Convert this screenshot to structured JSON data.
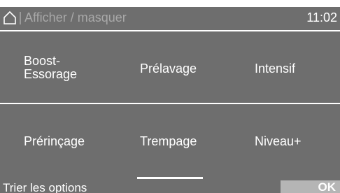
{
  "header": {
    "home_icon": "home-icon",
    "title": "Afficher / masquer",
    "time": "11:02"
  },
  "options": {
    "row1": {
      "boost_line1": "Boost-",
      "boost_line2": "Essorage",
      "prelavage": "Prélavage",
      "intensif": "Intensif"
    },
    "row2": {
      "prerincage": "Prérinçage",
      "trempage": "Trempage",
      "niveau": "Niveau+"
    }
  },
  "footer": {
    "sort_label": "Trier les options",
    "ok_label": "OK"
  },
  "colors": {
    "background": "#6e6e6e",
    "text": "#ffffff",
    "title_text": "#a8a8a8",
    "ok_button": "#b5b5b5"
  }
}
